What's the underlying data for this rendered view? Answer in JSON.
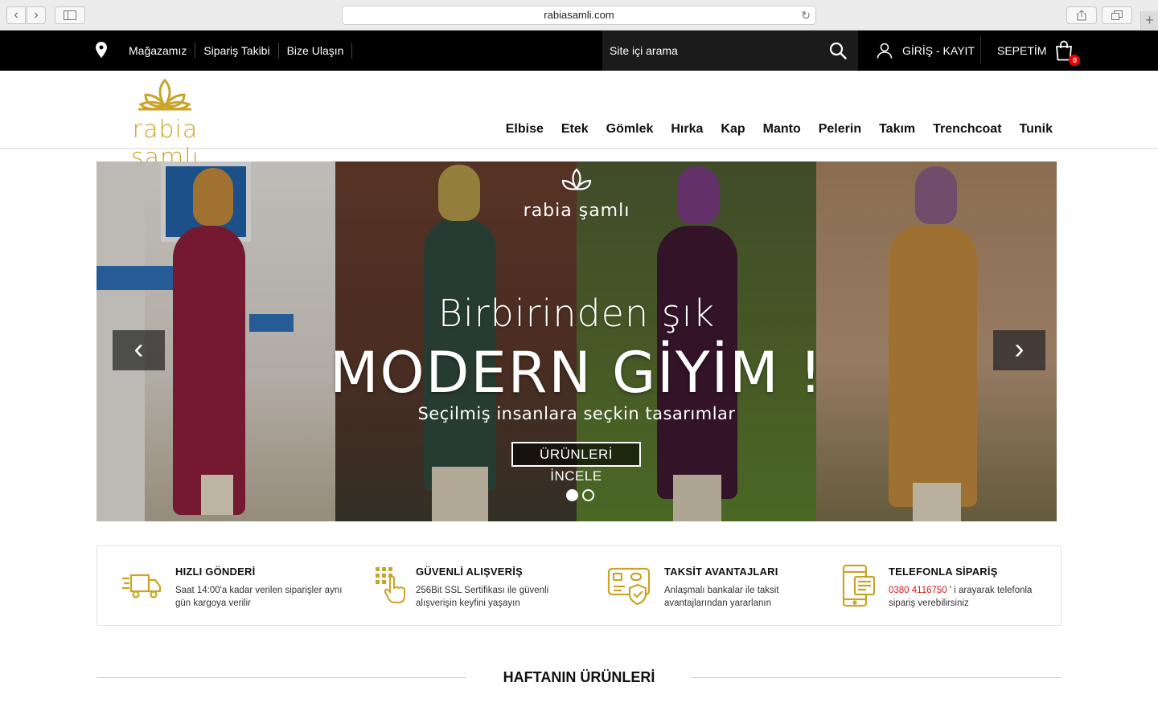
{
  "browser": {
    "url": "rabiasamli.com",
    "back_glyph": "‹",
    "forward_glyph": "›",
    "reload_glyph": "↻",
    "plus_glyph": "+"
  },
  "topbar": {
    "links": [
      "Mağazamız",
      "Sipariş Takibi",
      "Bize Ulaşın"
    ],
    "search_placeholder": "Site içi arama",
    "login_label": "GİRİŞ - KAYIT",
    "cart_label": "SEPETİM",
    "cart_count": "0"
  },
  "header": {
    "logo_text": "rabia şamlı",
    "categories": [
      "Elbise",
      "Etek",
      "Gömlek",
      "Hırka",
      "Kap",
      "Manto",
      "Pelerin",
      "Takım",
      "Trenchcoat",
      "Tunik"
    ]
  },
  "slider": {
    "logo_text": "rabia şamlı",
    "heading_small": "Birbirinden şık",
    "heading_large": "MODERN GİYİM !",
    "subtitle": "Seçilmiş insanlara seçkin tasarımlar",
    "button_label": "ÜRÜNLERİ İNCELE",
    "prev_glyph": "‹",
    "next_glyph": "›",
    "active_slide": 1,
    "slide_count": 2
  },
  "features": [
    {
      "icon": "truck-icon",
      "title": "HIZLI GÖNDERİ",
      "desc": "Saat 14:00'a kadar verilen siparişler aynı gün kargoya verilir"
    },
    {
      "icon": "secure-touch-icon",
      "title": "GÜVENLİ ALIŞVERİŞ",
      "desc": "256Bit SSL Sertifikası ile güvenli alışverişin keyfini yaşayın"
    },
    {
      "icon": "credit-card-shield-icon",
      "title": "TAKSİT AVANTAJLARI",
      "desc": "Anlaşmalı bankalar ile taksit avantajlarından yararlanın"
    },
    {
      "icon": "phone-icon",
      "title": "TELEFONLA SİPARİŞ",
      "phone": "0380 4116750",
      "desc_rest": " ' i arayarak telefonla sipariş verebilirsiniz"
    }
  ],
  "section_title": "HAFTANIN ÜRÜNLERİ",
  "colors": {
    "gold": "#c9a428",
    "black": "#000000",
    "badge": "#e00000",
    "phone": "#d61a1a"
  }
}
